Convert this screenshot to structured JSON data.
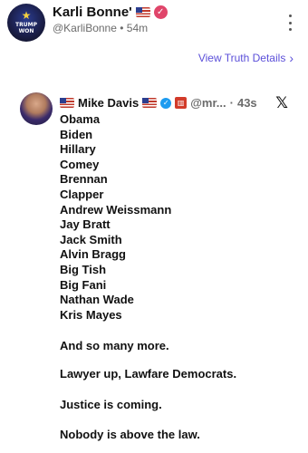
{
  "post": {
    "author_name": "Karli Bonne'",
    "author_flag": "us-flag",
    "author_badge": "verified-badge-pink",
    "handle": "@KarliBonne",
    "separator": "•",
    "time": "54m",
    "more_menu": "more-vertical-icon",
    "view_link": "View Truth Details",
    "avatar_text": "TRUMP WON"
  },
  "embed": {
    "author_name": "Mike Davis",
    "handle": "@mr...",
    "separator": "·",
    "time": "43s",
    "platform_icon": "x-logo-icon",
    "names": [
      "Obama",
      "Biden",
      "Hillary",
      "Comey",
      "Brennan",
      "Clapper",
      "Andrew Weissmann",
      "Jay Bratt",
      "Jack Smith",
      "Alvin Bragg",
      "Big Tish",
      "Big Fani",
      "Nathan Wade",
      "Kris Mayes"
    ],
    "para1": "And so many more.",
    "para2": "Lawyer up, Lawfare Democrats.",
    "para3": "Justice is coming.",
    "para4": "Nobody is above the law."
  },
  "colors": {
    "link": "#5b4fd9",
    "verified_pink": "#e0456a",
    "verified_blue": "#1d9bf0",
    "muted": "#6b6b6b"
  }
}
